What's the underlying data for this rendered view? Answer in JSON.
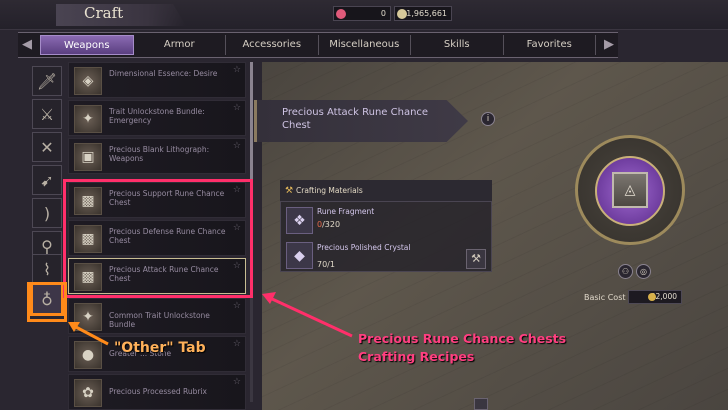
{
  "header": {
    "title": "Craft",
    "currency": [
      {
        "name": "gem",
        "value": "0",
        "color": "#e05a7a"
      },
      {
        "name": "silver",
        "value": "1,965,661",
        "color": "#d7c99a"
      }
    ]
  },
  "tabs": [
    {
      "label": "Weapons",
      "active": true
    },
    {
      "label": "Armor",
      "active": false
    },
    {
      "label": "Accessories",
      "active": false
    },
    {
      "label": "Miscellaneous",
      "active": false
    },
    {
      "label": "Skills",
      "active": false
    },
    {
      "label": "Favorites",
      "active": false
    }
  ],
  "sidebar": {
    "icons": [
      "dagger-icon",
      "greatsword-icon",
      "crossed-blades-icon",
      "crossbow-icon",
      "longbow-icon",
      "staff-icon",
      "wand-icon",
      "other-bag-icon"
    ]
  },
  "recipes": [
    {
      "name": "Dimensional Essence: Desire"
    },
    {
      "name": "Trait Unlockstone Bundle: Emergency"
    },
    {
      "name": "Precious Blank Lithograph: Weapons"
    },
    {
      "name": "Precious Support Rune Chance Chest"
    },
    {
      "name": "Precious Defense Rune Chance Chest"
    },
    {
      "name": "Precious Attack Rune Chance Chest",
      "selected": true
    },
    {
      "name": "Common Trait Unlockstone Bundle"
    },
    {
      "name": "Greater ... Stone"
    },
    {
      "name": "Precious Processed Rubrix"
    }
  ],
  "detail": {
    "title": "Precious Attack Rune Chance Chest",
    "materials_header": "Crafting Materials",
    "materials": [
      {
        "name": "Rune Fragment",
        "have": "0",
        "need": "320"
      },
      {
        "name": "Precious Polished Crystal",
        "qty": "70/1"
      }
    ],
    "cost_label": "Basic Cost",
    "cost_value": "32,000"
  },
  "annotations": {
    "other_tab": "\"Other\" Tab",
    "chests_line1": "Precious Rune Chance Chests",
    "chests_line2": "Crafting Recipes",
    "highlight_color": "#ff2f6a",
    "other_color": "#ff8a1a"
  }
}
